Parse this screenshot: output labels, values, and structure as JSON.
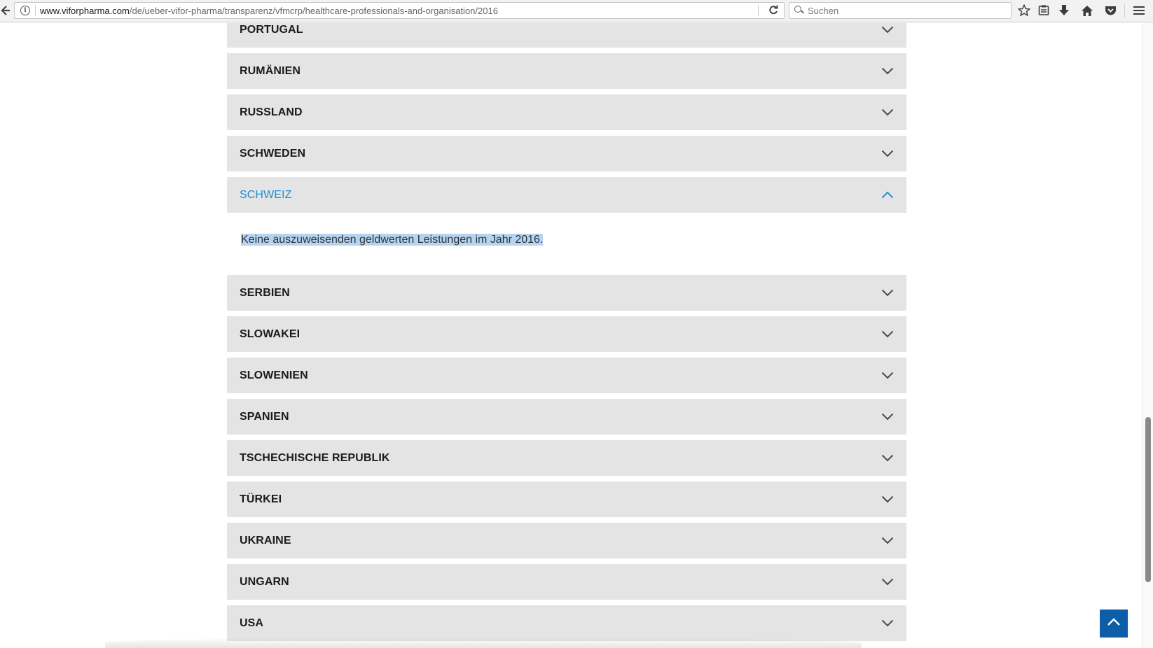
{
  "browser": {
    "url_domain": "www.viforpharma.com",
    "url_path": "/de/ueber-vifor-pharma/transparenz/vfmcrp/healthcare-professionals-and-organisation/2016",
    "search_placeholder": "Suchen",
    "info_icon_glyph": "i"
  },
  "accordion": {
    "items": [
      {
        "label": "PORTUGAL",
        "open": false
      },
      {
        "label": "RUMÄNIEN",
        "open": false
      },
      {
        "label": "RUSSLAND",
        "open": false
      },
      {
        "label": "SCHWEDEN",
        "open": false
      },
      {
        "label": "SCHWEIZ",
        "open": true,
        "content": "Keine auszuweisenden geldwerten Leistungen im Jahr 2016."
      },
      {
        "label": "SERBIEN",
        "open": false
      },
      {
        "label": "SLOWAKEI",
        "open": false
      },
      {
        "label": "SLOWENIEN",
        "open": false
      },
      {
        "label": "SPANIEN",
        "open": false
      },
      {
        "label": "TSCHECHISCHE REPUBLIK",
        "open": false
      },
      {
        "label": "TÜRKEI",
        "open": false
      },
      {
        "label": "UKRAINE",
        "open": false
      },
      {
        "label": "UNGARN",
        "open": false
      },
      {
        "label": "USA",
        "open": false
      }
    ]
  },
  "colors": {
    "header_bg": "#e5e4e5",
    "active_title": "#1d8fd3",
    "selection": "#b5d4f2",
    "back_to_top": "#0d5ea8"
  },
  "icons": {
    "collapsed": "chevron-down-icon",
    "expanded": "chevron-up-icon",
    "back_to_top": "arrow-up-icon"
  }
}
